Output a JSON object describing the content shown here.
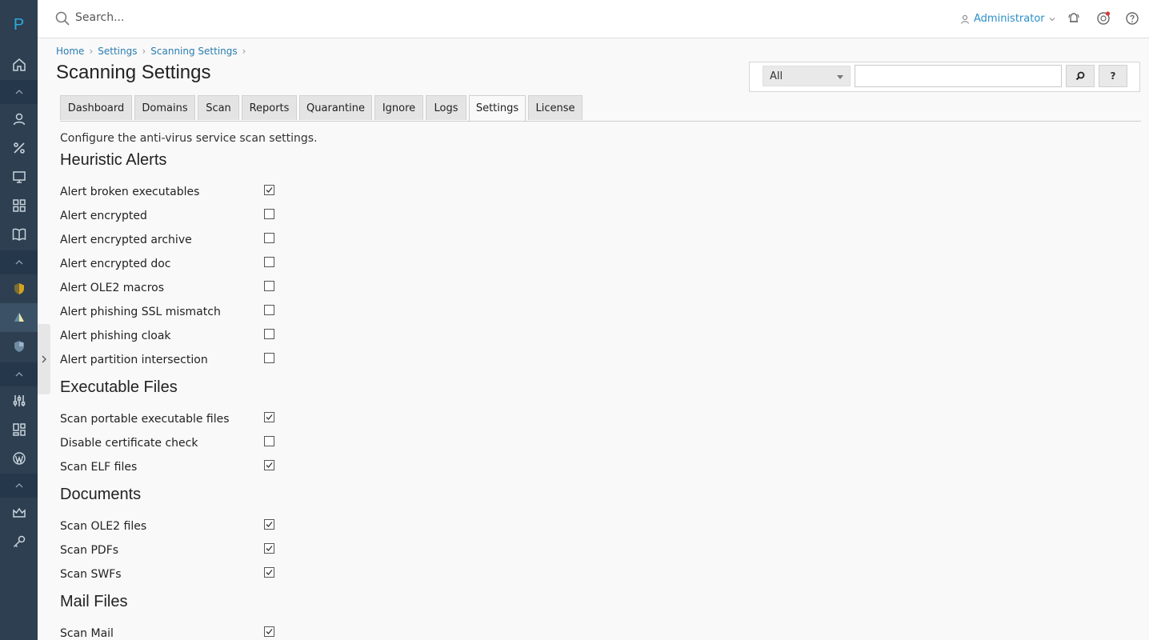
{
  "sidebar": {
    "logo": "P",
    "items": [
      {
        "name": "home-icon"
      },
      {
        "name": "user-icon"
      },
      {
        "name": "percent-icon"
      },
      {
        "name": "monitor-icon"
      },
      {
        "name": "apps-icon"
      },
      {
        "name": "book-icon"
      },
      {
        "name": "shield-yellow-icon"
      },
      {
        "name": "antivirus-icon"
      },
      {
        "name": "shield-blue-icon"
      },
      {
        "name": "sliders-icon"
      },
      {
        "name": "layout-icon"
      },
      {
        "name": "wordpress-icon"
      },
      {
        "name": "crown-icon"
      },
      {
        "name": "key-icon"
      }
    ]
  },
  "topbar": {
    "search_placeholder": "Search...",
    "user": "Administrator"
  },
  "breadcrumb": [
    "Home",
    "Settings",
    "Scanning Settings"
  ],
  "page_title": "Scanning Settings",
  "filter": {
    "select_value": "All",
    "search_btn": "⌕",
    "help_btn": "?"
  },
  "tabs": [
    "Dashboard",
    "Domains",
    "Scan",
    "Reports",
    "Quarantine",
    "Ignore",
    "Logs",
    "Settings",
    "License"
  ],
  "active_tab": "Settings",
  "intro": "Configure the anti-virus service scan settings.",
  "sections": [
    {
      "title": "Heuristic Alerts",
      "rows": [
        {
          "label": "Alert broken executables",
          "checked": true
        },
        {
          "label": "Alert encrypted",
          "checked": false
        },
        {
          "label": "Alert encrypted archive",
          "checked": false
        },
        {
          "label": "Alert encrypted doc",
          "checked": false
        },
        {
          "label": "Alert OLE2 macros",
          "checked": false
        },
        {
          "label": "Alert phishing SSL mismatch",
          "checked": false
        },
        {
          "label": "Alert phishing cloak",
          "checked": false
        },
        {
          "label": "Alert partition intersection",
          "checked": false
        }
      ]
    },
    {
      "title": "Executable Files",
      "rows": [
        {
          "label": "Scan portable executable files",
          "checked": true
        },
        {
          "label": "Disable certificate check",
          "checked": false
        },
        {
          "label": "Scan ELF files",
          "checked": true
        }
      ]
    },
    {
      "title": "Documents",
      "rows": [
        {
          "label": "Scan OLE2 files",
          "checked": true
        },
        {
          "label": "Scan PDFs",
          "checked": true
        },
        {
          "label": "Scan SWFs",
          "checked": true
        }
      ]
    },
    {
      "title": "Mail Files",
      "rows": [
        {
          "label": "Scan Mail",
          "checked": true
        }
      ]
    }
  ],
  "colors": {
    "sidebar": "#2d3f50",
    "accent": "#2a8fc8",
    "background": "#f9f9f9"
  }
}
